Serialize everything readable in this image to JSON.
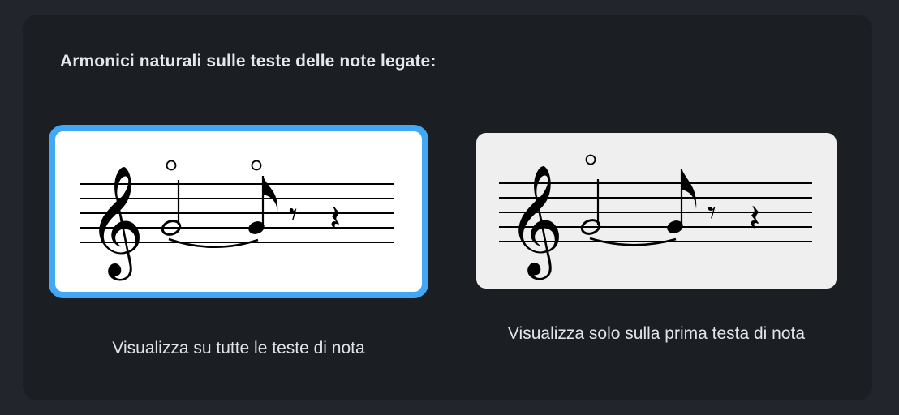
{
  "heading": "Armonici naturali sulle teste delle note legate:",
  "options": [
    {
      "caption": "Visualizza su tutte le teste di nota",
      "selected": true
    },
    {
      "caption": "Visualizza solo sulla prima testa di nota",
      "selected": false
    }
  ],
  "colors": {
    "selection_border": "#42a8f5",
    "panel": "#1b1e23",
    "background": "#22262c"
  }
}
